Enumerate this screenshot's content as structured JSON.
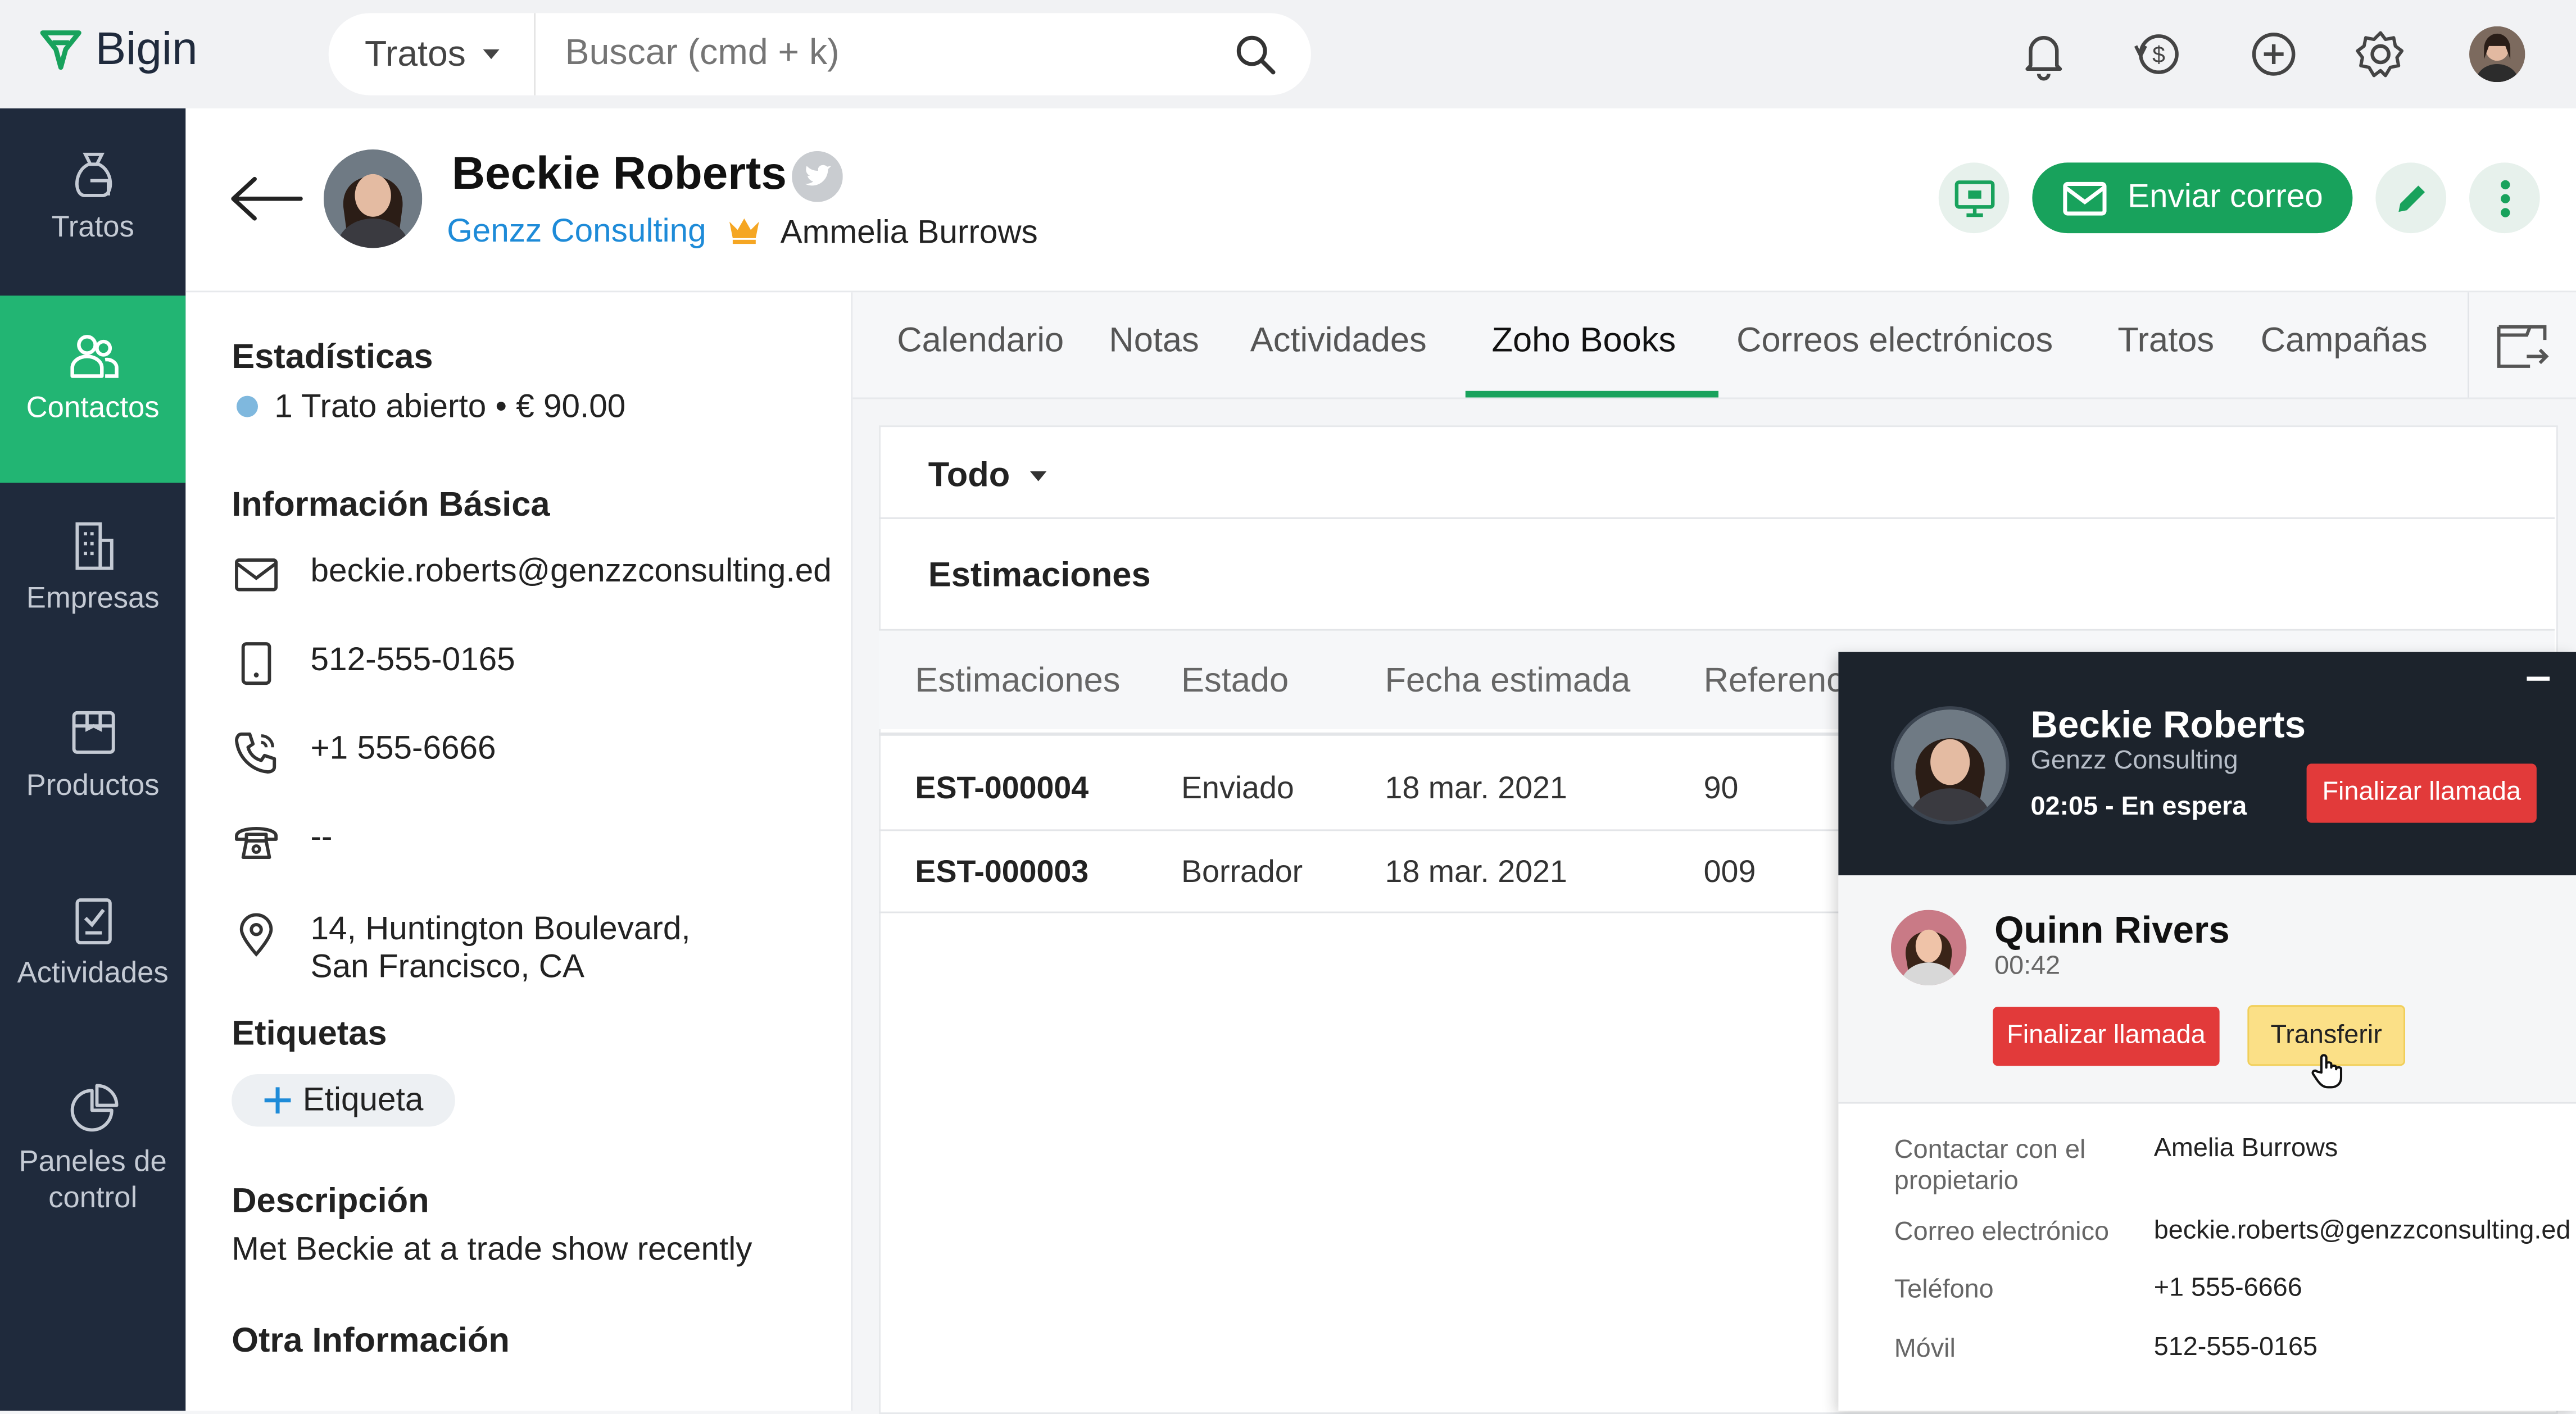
{
  "app": {
    "name": "Bigin"
  },
  "search": {
    "scope": "Tratos",
    "placeholder": "Buscar (cmd + k)"
  },
  "sidebar": {
    "items": [
      {
        "label": "Tratos",
        "active": false
      },
      {
        "label": "Contactos",
        "active": true
      },
      {
        "label": "Empresas",
        "active": false
      },
      {
        "label": "Productos",
        "active": false
      },
      {
        "label": "Actividades",
        "active": false
      },
      {
        "label": "Paneles de control",
        "active": false
      }
    ]
  },
  "contact": {
    "name": "Beckie Roberts",
    "company": "Genzz Consulting",
    "owner": "Ammelia Burrows",
    "send_mail_label": "Enviar correo"
  },
  "stats": {
    "title": "Estadísticas",
    "summary": "1 Trato abierto • € 90.00"
  },
  "basic": {
    "title": "Información Básica",
    "email": "beckie.roberts@genzzconsulting.ed",
    "mobile": "512-555-0165",
    "phone": "+1 555-6666",
    "other_phone": "--",
    "address_line1": "14, Huntington Boulevard,",
    "address_line2": "San Francisco, CA"
  },
  "tags": {
    "title": "Etiquetas",
    "add_label": "Etiqueta"
  },
  "description": {
    "title": "Descripción",
    "text": "Met Beckie at a trade show recently"
  },
  "other": {
    "title": "Otra Información"
  },
  "tabs": [
    "Calendario",
    "Notas",
    "Actividades",
    "Zoho Books",
    "Correos electrónicos",
    "Tratos",
    "Campañas"
  ],
  "active_tab": "Zoho Books",
  "filter": {
    "value": "Todo"
  },
  "estimates": {
    "title": "Estimaciones",
    "columns": [
      "Estimaciones",
      "Estado",
      "Fecha estimada",
      "Referenc"
    ],
    "rows": [
      [
        "EST-000004",
        "Enviado",
        "18 mar. 2021",
        "90"
      ],
      [
        "EST-000003",
        "Borrador",
        "18 mar. 2021",
        "009"
      ]
    ]
  },
  "call": {
    "caller_name": "Beckie Roberts",
    "caller_company": "Genzz Consulting",
    "status": "02:05 - En espera",
    "end_call_label": "Finalizar llamada",
    "active_name": "Quinn Rivers",
    "active_time": "00:42",
    "transfer_label": "Transferir",
    "details": [
      {
        "label": "Contactar con el propietario",
        "value": "Amelia Burrows"
      },
      {
        "label": "Correo electrónico",
        "value": "beckie.roberts@genzzconsulting.ed"
      },
      {
        "label": "Teléfono",
        "value": "+1 555-6666"
      },
      {
        "label": "Móvil",
        "value": "512-555-0165"
      }
    ]
  },
  "colors": {
    "brand_green": "#18a25c",
    "sidebar_bg": "#1f2a3c",
    "active_nav": "#22b573",
    "link_blue": "#1e8bd8",
    "danger": "#e23a3a",
    "warning": "#fbe087"
  }
}
